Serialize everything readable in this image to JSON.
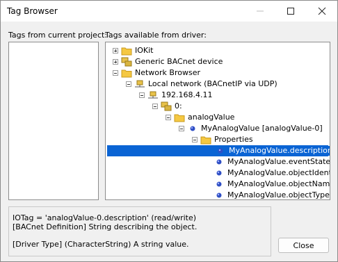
{
  "window": {
    "title": "Tag Browser"
  },
  "labels": {
    "left": "Tags from current project:",
    "right": "Tags available from driver:"
  },
  "tree": [
    {
      "label": "IOKit",
      "icon": "folder-icon",
      "expander": "plus",
      "depth": 0,
      "selected": false
    },
    {
      "label": "Generic BACnet device",
      "icon": "device-icon",
      "expander": "plus",
      "depth": 0,
      "selected": false
    },
    {
      "label": "Network Browser",
      "icon": "folder-icon",
      "expander": "minus",
      "depth": 0,
      "selected": false
    },
    {
      "label": "Local network (BACnetIP via UDP)",
      "icon": "network-icon",
      "expander": "minus",
      "depth": 1,
      "selected": false
    },
    {
      "label": "192.168.4.11",
      "icon": "network-icon",
      "expander": "minus",
      "depth": 2,
      "selected": false
    },
    {
      "label": "0:",
      "icon": "device-icon",
      "expander": "minus",
      "depth": 3,
      "selected": false
    },
    {
      "label": "analogValue",
      "icon": "folder-icon",
      "expander": "minus",
      "depth": 4,
      "selected": false
    },
    {
      "label": "MyAnalogValue [analogValue-0]",
      "icon": "object-dot-icon",
      "expander": "minus",
      "depth": 5,
      "selected": false
    },
    {
      "label": "Properties",
      "icon": "folder-icon",
      "expander": "minus",
      "depth": 6,
      "selected": false
    },
    {
      "label": "MyAnalogValue.description",
      "icon": "property-dot-icon",
      "expander": "",
      "depth": 7,
      "selected": true
    },
    {
      "label": "MyAnalogValue.eventState",
      "icon": "property-dot-icon",
      "expander": "",
      "depth": 7,
      "selected": false
    },
    {
      "label": "MyAnalogValue.objectIdentifier",
      "icon": "property-dot-icon",
      "expander": "",
      "depth": 7,
      "selected": false
    },
    {
      "label": "MyAnalogValue.objectName",
      "icon": "property-dot-icon",
      "expander": "",
      "depth": 7,
      "selected": false
    },
    {
      "label": "MyAnalogValue.objectType",
      "icon": "property-dot-icon",
      "expander": "",
      "depth": 7,
      "selected": false
    }
  ],
  "info": {
    "line1": "IOTag = 'analogValue-0.description' (read/write)",
    "line2": "[BACnet Definition] String describing the object.",
    "line3": "[Driver Type] (CharacterString) A string value."
  },
  "buttons": {
    "close": "Close"
  },
  "colors": {
    "selection": "#0a64d4",
    "folder": "#f5c842",
    "dot": "#2f4fc4"
  }
}
